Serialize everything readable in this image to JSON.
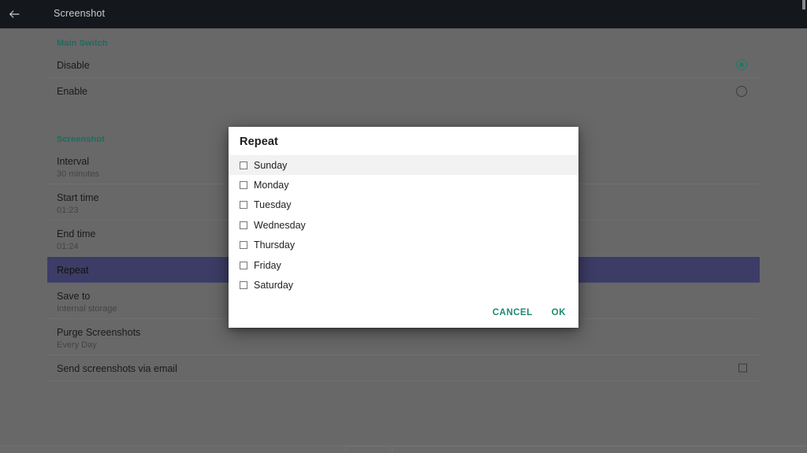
{
  "toolbar": {
    "title": "Screenshot",
    "back_icon": "arrow-left-icon"
  },
  "settings": {
    "sections": [
      {
        "header": "Main Switch",
        "rows": [
          {
            "title": "Disable",
            "sub": "",
            "control": "radio",
            "selected": true
          },
          {
            "title": "Enable",
            "sub": "",
            "control": "radio",
            "selected": false
          }
        ]
      },
      {
        "header": "Screenshot",
        "rows": [
          {
            "title": "Interval",
            "sub": "30 minutes",
            "control": "none",
            "selected": false
          },
          {
            "title": "Start time",
            "sub": "01:23",
            "control": "none",
            "selected": false
          },
          {
            "title": "End time",
            "sub": "01:24",
            "control": "none",
            "selected": false
          },
          {
            "title": "Repeat",
            "sub": "",
            "control": "none",
            "selected": true
          },
          {
            "title": "Save to",
            "sub": "Internal storage",
            "control": "none",
            "selected": false
          },
          {
            "title": "Purge Screenshots",
            "sub": "Every Day",
            "control": "none",
            "selected": false
          },
          {
            "title": "Send screenshots via email",
            "sub": "",
            "control": "checkbox",
            "selected": false
          }
        ]
      }
    ]
  },
  "dialog": {
    "title": "Repeat",
    "days": [
      {
        "label": "Sunday",
        "checked": false,
        "highlighted": true
      },
      {
        "label": "Monday",
        "checked": false,
        "highlighted": false
      },
      {
        "label": "Tuesday",
        "checked": false,
        "highlighted": false
      },
      {
        "label": "Wednesday",
        "checked": false,
        "highlighted": false
      },
      {
        "label": "Thursday",
        "checked": false,
        "highlighted": false
      },
      {
        "label": "Friday",
        "checked": false,
        "highlighted": false
      },
      {
        "label": "Saturday",
        "checked": false,
        "highlighted": false
      }
    ],
    "cancel_label": "CANCEL",
    "ok_label": "OK"
  },
  "colors": {
    "toolbar_bg": "#14181c",
    "content_bg": "#686868",
    "accent_teal": "#1f8a71",
    "section_header": "#1f6b5e",
    "selected_row": "#3c3c66",
    "dialog_bg": "#ffffff"
  }
}
